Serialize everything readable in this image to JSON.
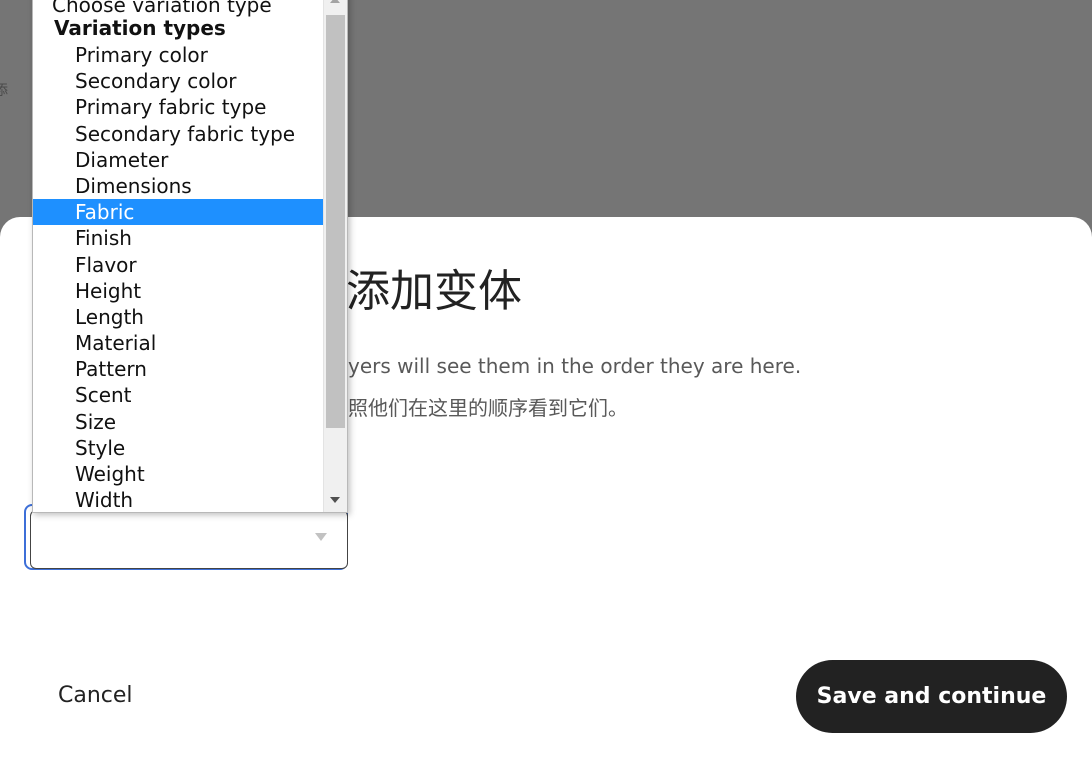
{
  "backdrop": {
    "edge_glyph": "添"
  },
  "modal": {
    "title": "添加变体",
    "description_en": "yers will see them in the order they are here.",
    "description_zh": "照他们在这里的顺序看到它们。"
  },
  "select": {
    "value": ""
  },
  "dropdown": {
    "header": "Choose variation type",
    "group_label": "Variation types",
    "selected": "Fabric",
    "options": [
      "Primary color",
      "Secondary color",
      "Primary fabric type",
      "Secondary fabric type",
      "Diameter",
      "Dimensions",
      "Fabric",
      "Finish",
      "Flavor",
      "Height",
      "Length",
      "Material",
      "Pattern",
      "Scent",
      "Size",
      "Style",
      "Weight",
      "Width"
    ]
  },
  "actions": {
    "cancel_label": "Cancel",
    "save_label": "Save and continue"
  },
  "colors": {
    "backdrop": "#757575",
    "selected_option": "#1e90ff",
    "primary_button": "#222222",
    "focus_ring": "#3d6fd8"
  }
}
